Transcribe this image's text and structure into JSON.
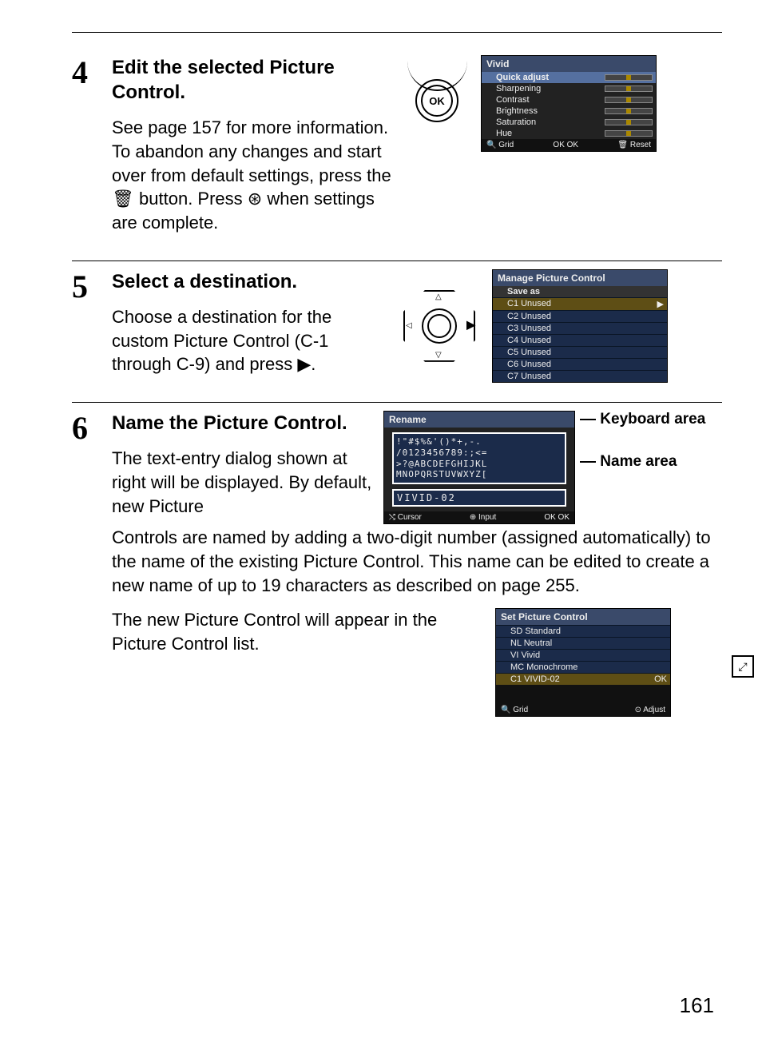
{
  "page_number": "161",
  "steps": {
    "s4": {
      "num": "4",
      "title": "Edit the selected Picture Control.",
      "body": "See page 157 for more information.  To abandon any changes and start over from default settings, press the 🗑 button.  Press ⊛ when settings are complete."
    },
    "s5": {
      "num": "5",
      "title": "Select a destination.",
      "body": "Choose a destination for the custom Picture Control (C-1 through C-9) and press ▶."
    },
    "s6": {
      "num": "6",
      "title": "Name the Picture Control.",
      "body1": "The text-entry dialog shown at right will be displayed.  By default, new Picture",
      "body2": "Controls are named by adding a two-digit number (assigned automatically) to the name of the existing Picture Control.  This name can be edited to create a new name of up to 19 characters as described on page 255.",
      "body3": "The new Picture Control will appear in the Picture Control list."
    }
  },
  "ok_label": "OK",
  "cam_vivid": {
    "title": "Vivid",
    "rows": [
      "Quick adjust",
      "Sharpening",
      "Contrast",
      "Brightness",
      "Saturation",
      "Hue"
    ],
    "footer": {
      "grid": "Grid",
      "ok": "OK",
      "reset": "Reset"
    }
  },
  "cam_manage": {
    "title": "Manage Picture Control",
    "subtitle": "Save as",
    "rows": [
      "C1 Unused",
      "C2 Unused",
      "C3 Unused",
      "C4 Unused",
      "C5 Unused",
      "C6 Unused",
      "C7 Unused"
    ]
  },
  "cam_rename": {
    "title": "Rename",
    "kbd_lines": [
      " !\"#$%&'()*+,-.",
      "/0123456789:;<=",
      ">?@ABCDEFGHIJKL",
      "MNOPQRSTUVWXYZ["
    ],
    "name_value": "VIVID-02",
    "footer": {
      "cursor": "Cursor",
      "input": "Input",
      "ok": "OK"
    },
    "label_keyboard": "Keyboard area",
    "label_name": "Name area"
  },
  "cam_spc": {
    "title": "Set Picture Control",
    "rows": [
      "SD Standard",
      "NL Neutral",
      "VI Vivid",
      "MC Monochrome",
      "C1 VIVID-02"
    ],
    "footer": {
      "grid": "Grid",
      "adjust": "Adjust"
    },
    "ok": "OK"
  }
}
